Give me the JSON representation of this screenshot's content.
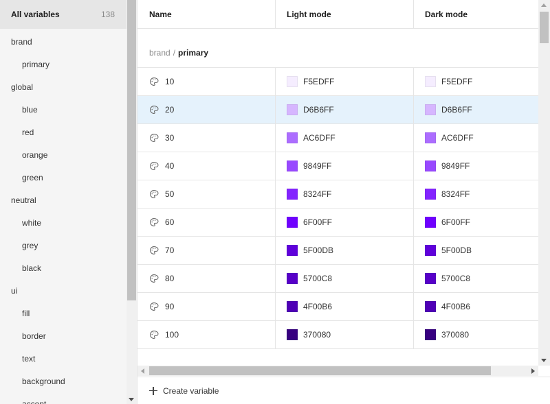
{
  "sidebar": {
    "all_label": "All variables",
    "all_count": "138",
    "items": [
      {
        "label": "brand",
        "level": "group"
      },
      {
        "label": "primary",
        "level": "child"
      },
      {
        "label": "global",
        "level": "group"
      },
      {
        "label": "blue",
        "level": "child"
      },
      {
        "label": "red",
        "level": "child"
      },
      {
        "label": "orange",
        "level": "child"
      },
      {
        "label": "green",
        "level": "child"
      },
      {
        "label": "neutral",
        "level": "group"
      },
      {
        "label": "white",
        "level": "child"
      },
      {
        "label": "grey",
        "level": "child"
      },
      {
        "label": "black",
        "level": "child"
      },
      {
        "label": "ui",
        "level": "group"
      },
      {
        "label": "fill",
        "level": "child"
      },
      {
        "label": "border",
        "level": "child"
      },
      {
        "label": "text",
        "level": "child"
      },
      {
        "label": "background",
        "level": "child"
      },
      {
        "label": "accent",
        "level": "child"
      }
    ]
  },
  "table": {
    "headers": {
      "name": "Name",
      "light": "Light mode",
      "dark": "Dark mode"
    },
    "group": {
      "parent": "brand",
      "separator": "/",
      "child": "primary"
    },
    "selected_row": "20",
    "rows": [
      {
        "name": "10",
        "light": "F5EDFF",
        "dark": "F5EDFF",
        "light_color": "#F5EDFF",
        "dark_color": "#F5EDFF"
      },
      {
        "name": "20",
        "light": "D6B6FF",
        "dark": "D6B6FF",
        "light_color": "#D6B6FF",
        "dark_color": "#D6B6FF"
      },
      {
        "name": "30",
        "light": "AC6DFF",
        "dark": "AC6DFF",
        "light_color": "#AC6DFF",
        "dark_color": "#AC6DFF"
      },
      {
        "name": "40",
        "light": "9849FF",
        "dark": "9849FF",
        "light_color": "#9849FF",
        "dark_color": "#9849FF"
      },
      {
        "name": "50",
        "light": "8324FF",
        "dark": "8324FF",
        "light_color": "#8324FF",
        "dark_color": "#8324FF"
      },
      {
        "name": "60",
        "light": "6F00FF",
        "dark": "6F00FF",
        "light_color": "#6F00FF",
        "dark_color": "#6F00FF"
      },
      {
        "name": "70",
        "light": "5F00DB",
        "dark": "5F00DB",
        "light_color": "#5F00DB",
        "dark_color": "#5F00DB"
      },
      {
        "name": "80",
        "light": "5700C8",
        "dark": "5700C8",
        "light_color": "#5700C8",
        "dark_color": "#5700C8"
      },
      {
        "name": "90",
        "light": "4F00B6",
        "dark": "4F00B6",
        "light_color": "#4F00B6",
        "dark_color": "#4F00B6"
      },
      {
        "name": "100",
        "light": "370080",
        "dark": "370080",
        "light_color": "#370080",
        "dark_color": "#370080"
      }
    ]
  },
  "footer": {
    "create_label": "Create variable"
  },
  "colors": {
    "selected_row_bg": "#e5f2fc",
    "sidebar_bg": "#f5f5f5"
  }
}
